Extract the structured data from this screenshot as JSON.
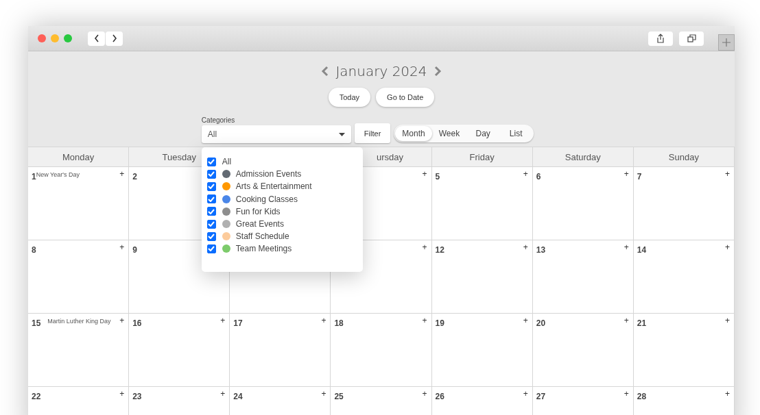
{
  "calendar": {
    "title": "January 2024",
    "buttons": [
      "Today",
      "Go to Date"
    ],
    "categories": {
      "label": "Categories",
      "value": "All",
      "expanded": true,
      "options": [
        {
          "label": "All",
          "checked": true
        },
        {
          "label": "Admission Events",
          "checked": true,
          "color": "#636a73"
        },
        {
          "label": "Arts & Entertainment",
          "checked": true,
          "color": "#ff9800"
        },
        {
          "label": "Cooking Classes",
          "checked": true,
          "color": "#4a86e8"
        },
        {
          "label": "Fun for Kids",
          "checked": true,
          "color": "#8e8e8e"
        },
        {
          "label": "Great Events",
          "checked": true,
          "color": "#b0b0b0"
        },
        {
          "label": "Staff Schedule",
          "checked": true,
          "color": "#fccb9b"
        },
        {
          "label": "Team Meetings",
          "checked": true,
          "color": "#7dcb6b"
        }
      ]
    },
    "filter": "Filter",
    "views": [
      {
        "label": "Month",
        "selected": true
      },
      {
        "label": "Week",
        "selected": false
      },
      {
        "label": "Day",
        "selected": false
      },
      {
        "label": "List",
        "selected": false
      }
    ],
    "columns": [
      {
        "header": "Monday",
        "cells": [
          {
            "day": "1",
            "plus": "+",
            "event": "New Year's Day"
          },
          {
            "day": "8",
            "plus": "+"
          },
          {
            "day": "15",
            "plus": "+",
            "event": "Martin Luther King Day"
          },
          {
            "day": "22",
            "plus": "+"
          }
        ]
      },
      {
        "header": "Tuesday",
        "cells": [
          {
            "day": "2"
          },
          {
            "day": "9"
          },
          {
            "day": "16",
            "plus": "+"
          },
          {
            "day": "23",
            "plus": "+"
          }
        ]
      },
      {
        "cells": [
          {
            "day": "17",
            "plus": "+"
          },
          {
            "day": "24",
            "plus": "+"
          }
        ]
      },
      {
        "header": "ursday",
        "cells": [
          {
            "plus": "+"
          },
          {
            "plus": "+"
          },
          {
            "day": "18",
            "plus": "+"
          },
          {
            "day": "25",
            "plus": "+"
          }
        ]
      },
      {
        "header": "Friday",
        "cells": [
          {
            "day": "5",
            "plus": "+"
          },
          {
            "day": "12",
            "plus": "+"
          },
          {
            "day": "19",
            "plus": "+"
          },
          {
            "day": "26",
            "plus": "+"
          }
        ]
      },
      {
        "header": "Saturday",
        "cells": [
          {
            "day": "6",
            "plus": "+"
          },
          {
            "day": "13",
            "plus": "+"
          },
          {
            "day": "20",
            "plus": "+"
          },
          {
            "day": "27",
            "plus": "+"
          }
        ]
      },
      {
        "header": "Sunday",
        "cells": [
          {
            "day": "7",
            "plus": "+"
          },
          {
            "day": "14",
            "plus": "+"
          },
          {
            "day": "21",
            "plus": "+"
          },
          {
            "day": "28",
            "plus": "+"
          }
        ]
      }
    ]
  }
}
